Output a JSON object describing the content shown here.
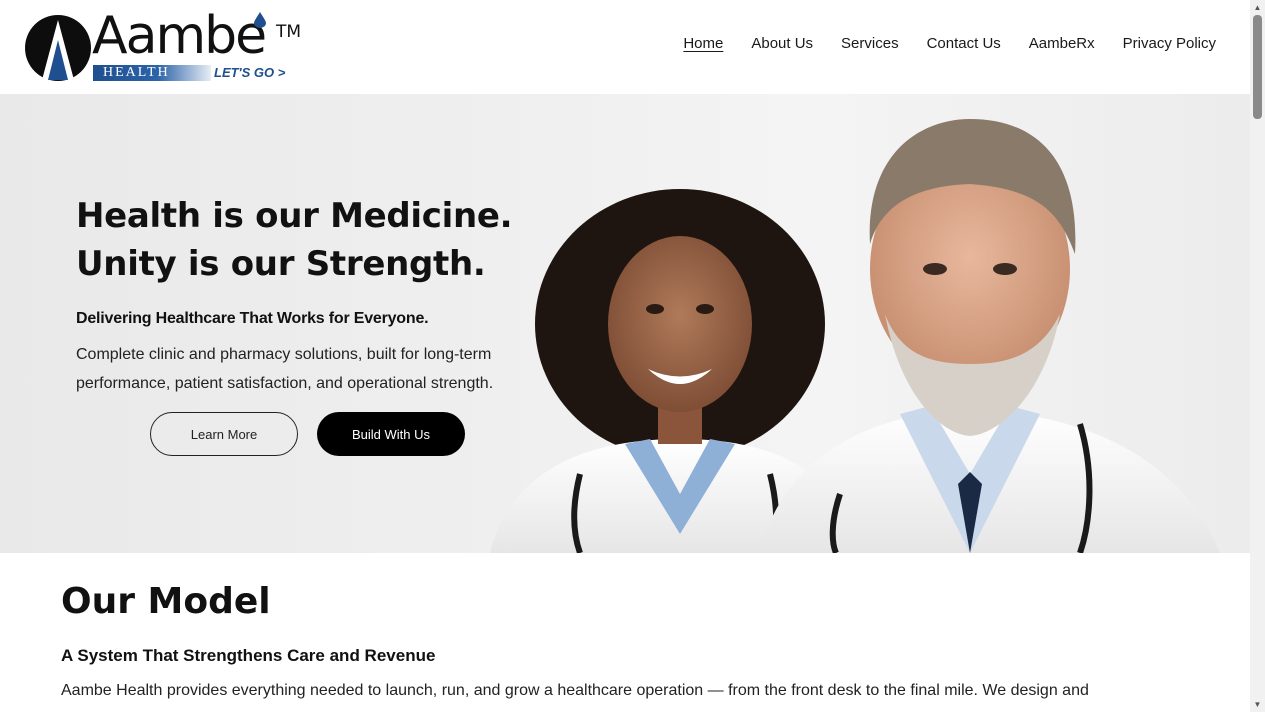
{
  "brand": {
    "name": "Aambe",
    "trademark": "TM",
    "tagline": "HEALTH",
    "slogan": "LET'S GO >",
    "primary_color": "#1f4f8f"
  },
  "nav": {
    "items": [
      {
        "label": "Home",
        "active": true
      },
      {
        "label": "About Us"
      },
      {
        "label": "Services"
      },
      {
        "label": "Contact Us"
      },
      {
        "label": "AambeRx"
      },
      {
        "label": "Privacy Policy"
      }
    ]
  },
  "hero": {
    "title_line1": "Health is our Medicine.",
    "title_line2": "Unity is our Strength.",
    "subtitle": "Delivering Healthcare That Works for Everyone.",
    "body": "Complete clinic and pharmacy solutions, built for long-term performance, patient satisfaction, and operational strength.",
    "learn_more": "Learn More",
    "build_with_us": "Build With Us",
    "image_subject": "two-doctors-portrait"
  },
  "model": {
    "title": "Our Model",
    "subtitle": "A System That Strengthens Care and Revenue",
    "body": "Aambe Health provides everything needed to launch, run, and grow a healthcare operation — from the front desk to the final mile. We design and"
  },
  "icons": {
    "scroll_up": "scroll-up-arrow-icon",
    "scroll_down": "scroll-down-arrow-icon"
  }
}
